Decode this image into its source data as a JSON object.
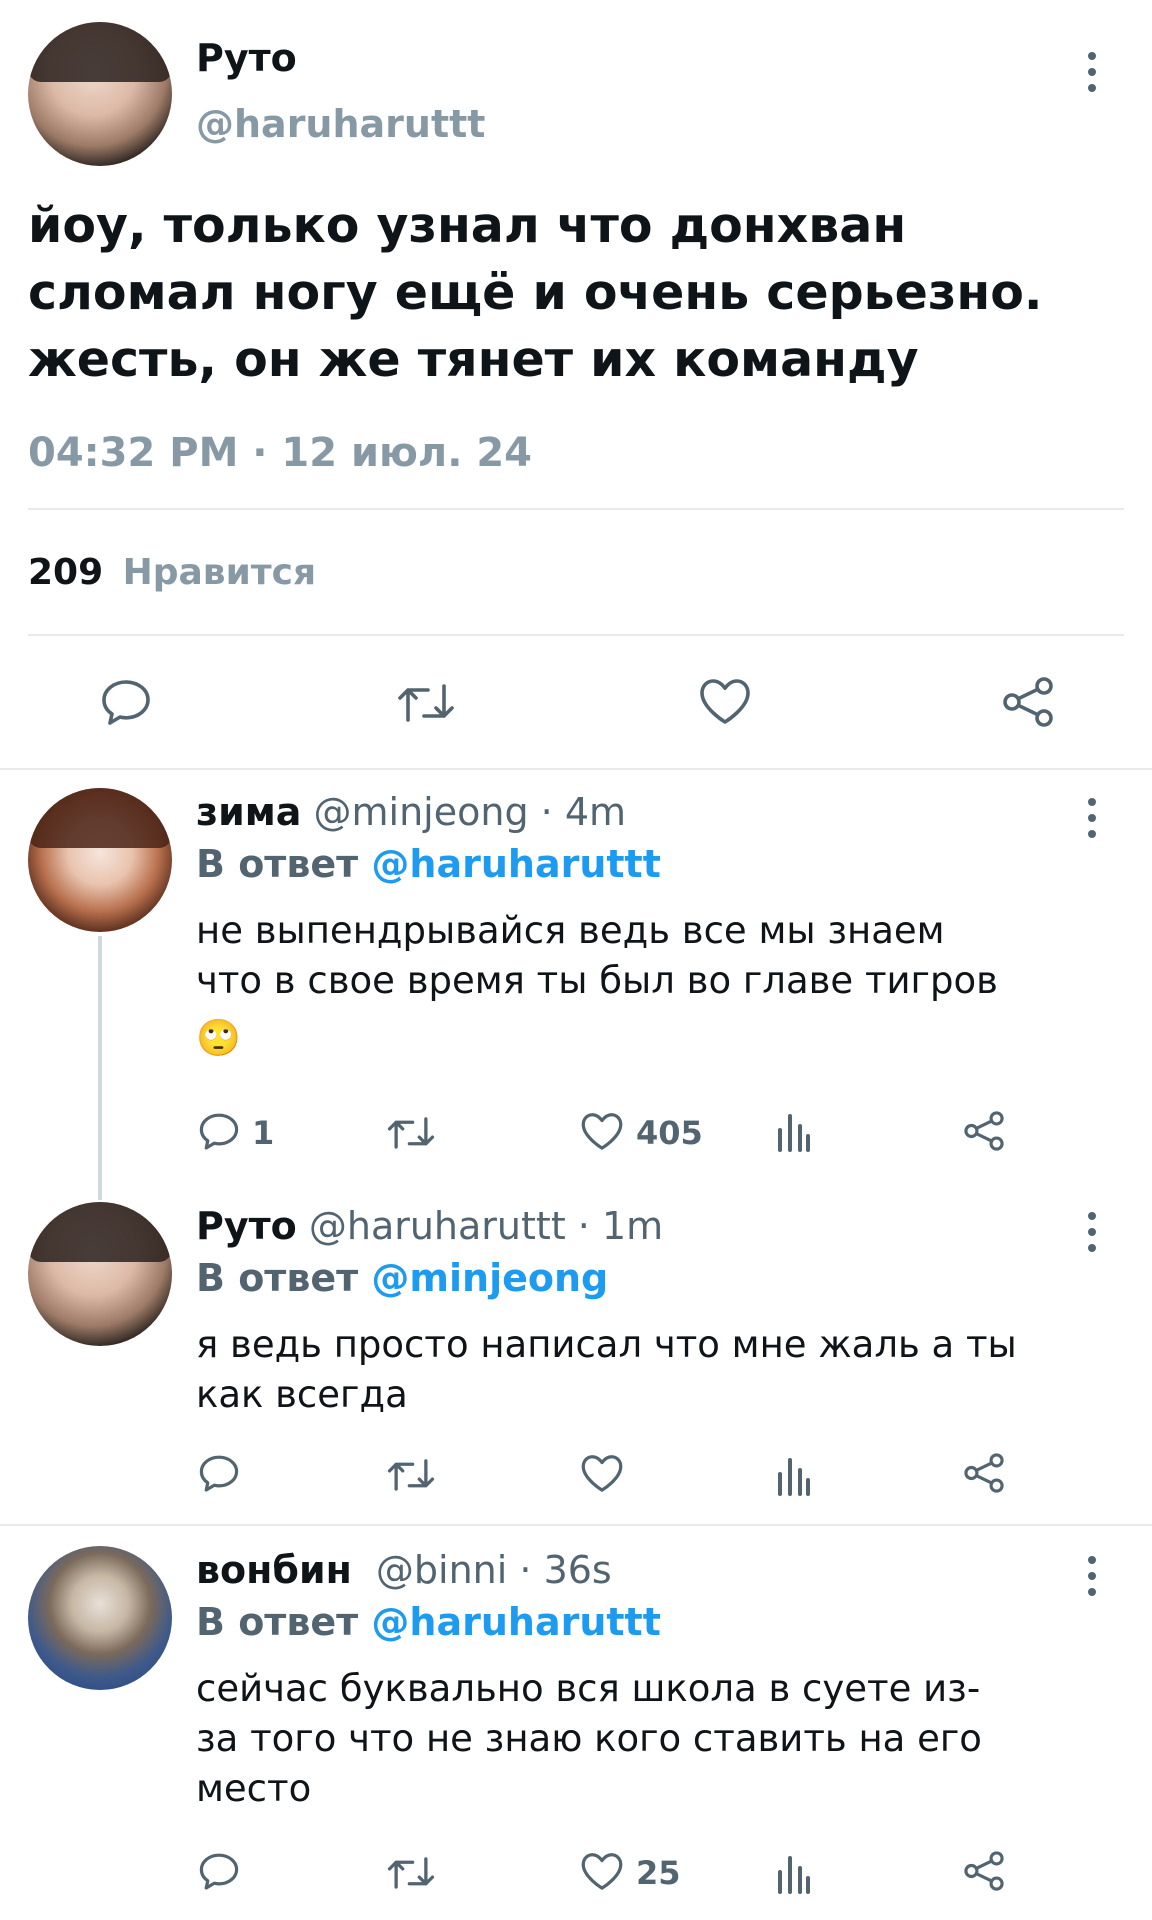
{
  "main_tweet": {
    "author_name": "Руто",
    "author_handle": "@haruharuttt",
    "text_lines": [
      "йоу, только узнал что донхван",
      "сломал ногу ещё и очень серьезно.",
      "жесть, он же тянет их команду"
    ],
    "timestamp": "04:32 PM · 12 июл. 24",
    "likes_count": "209",
    "likes_label": "Нравится"
  },
  "replies": [
    {
      "author_name": "зима",
      "author_handle": "@minjeong",
      "time": " · 4m",
      "reply_to_prefix": "В ответ ",
      "reply_to_handle": "@haruharuttt",
      "text_lines": [
        "не выпендрывайся ведь все мы знаем",
        "что в свое время ты был во главе тигров"
      ],
      "emoji": "🙄",
      "reply_count": "1",
      "like_count": "405"
    },
    {
      "author_name": "Руто",
      "author_handle": "@haruharuttt",
      "time": " · 1m",
      "reply_to_prefix": "В ответ ",
      "reply_to_handle": "@minjeong",
      "text_lines": [
        "я ведь просто написал что мне жаль а ты",
        "как всегда"
      ],
      "reply_count": "",
      "like_count": ""
    },
    {
      "author_name": "вонбин",
      "author_handle": "@binni",
      "time": " · 36s",
      "reply_to_prefix": "В ответ ",
      "reply_to_handle": "@haruharuttt",
      "text_lines": [
        "сейчас буквально вся школа в суете из-",
        "за того что не знаю кого ставить на его",
        "место"
      ],
      "reply_count": "",
      "like_count": "25"
    }
  ],
  "colors": {
    "accent": "#1d9bf0",
    "muted": "#536471",
    "divider": "#e7e9ea"
  },
  "icons": [
    "reply-icon",
    "retweet-icon",
    "like-icon",
    "share-icon",
    "views-icon",
    "more-icon"
  ]
}
